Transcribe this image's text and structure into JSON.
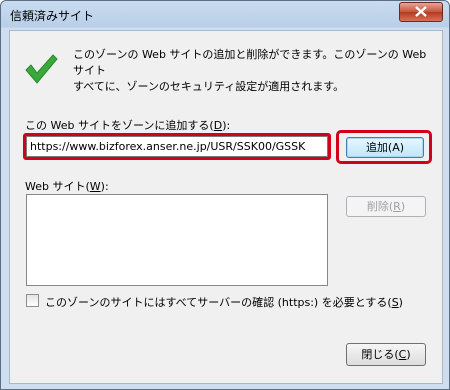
{
  "window": {
    "title": "信頼済みサイト"
  },
  "description": {
    "line1": "このゾーンの Web サイトの追加と削除ができます。このゾーンの Web サイト",
    "line2": "すべてに、ゾーンのセキュリティ設定が適用されます。"
  },
  "add_site": {
    "label": "この Web サイトをゾーンに追加する(",
    "label_key": "D",
    "label_end": "):",
    "value": "https://www.bizforex.anser.ne.jp/USR/SSK00/GSSK",
    "button": "追加(A)"
  },
  "sites": {
    "label": "Web サイト(",
    "label_key": "W",
    "label_end": "):",
    "items": [],
    "remove_label": "削除(",
    "remove_key": "R",
    "remove_end": ")"
  },
  "https_option": {
    "label": "このゾーンのサイトにはすべてサーバーの確認 (https:) を必要とする(",
    "key": "S",
    "end": ")",
    "checked": false
  },
  "close_button": {
    "label": "閉じる(",
    "key": "C",
    "end": ")"
  },
  "colors": {
    "highlight": "#d0021b",
    "check": "#3aa83a"
  }
}
